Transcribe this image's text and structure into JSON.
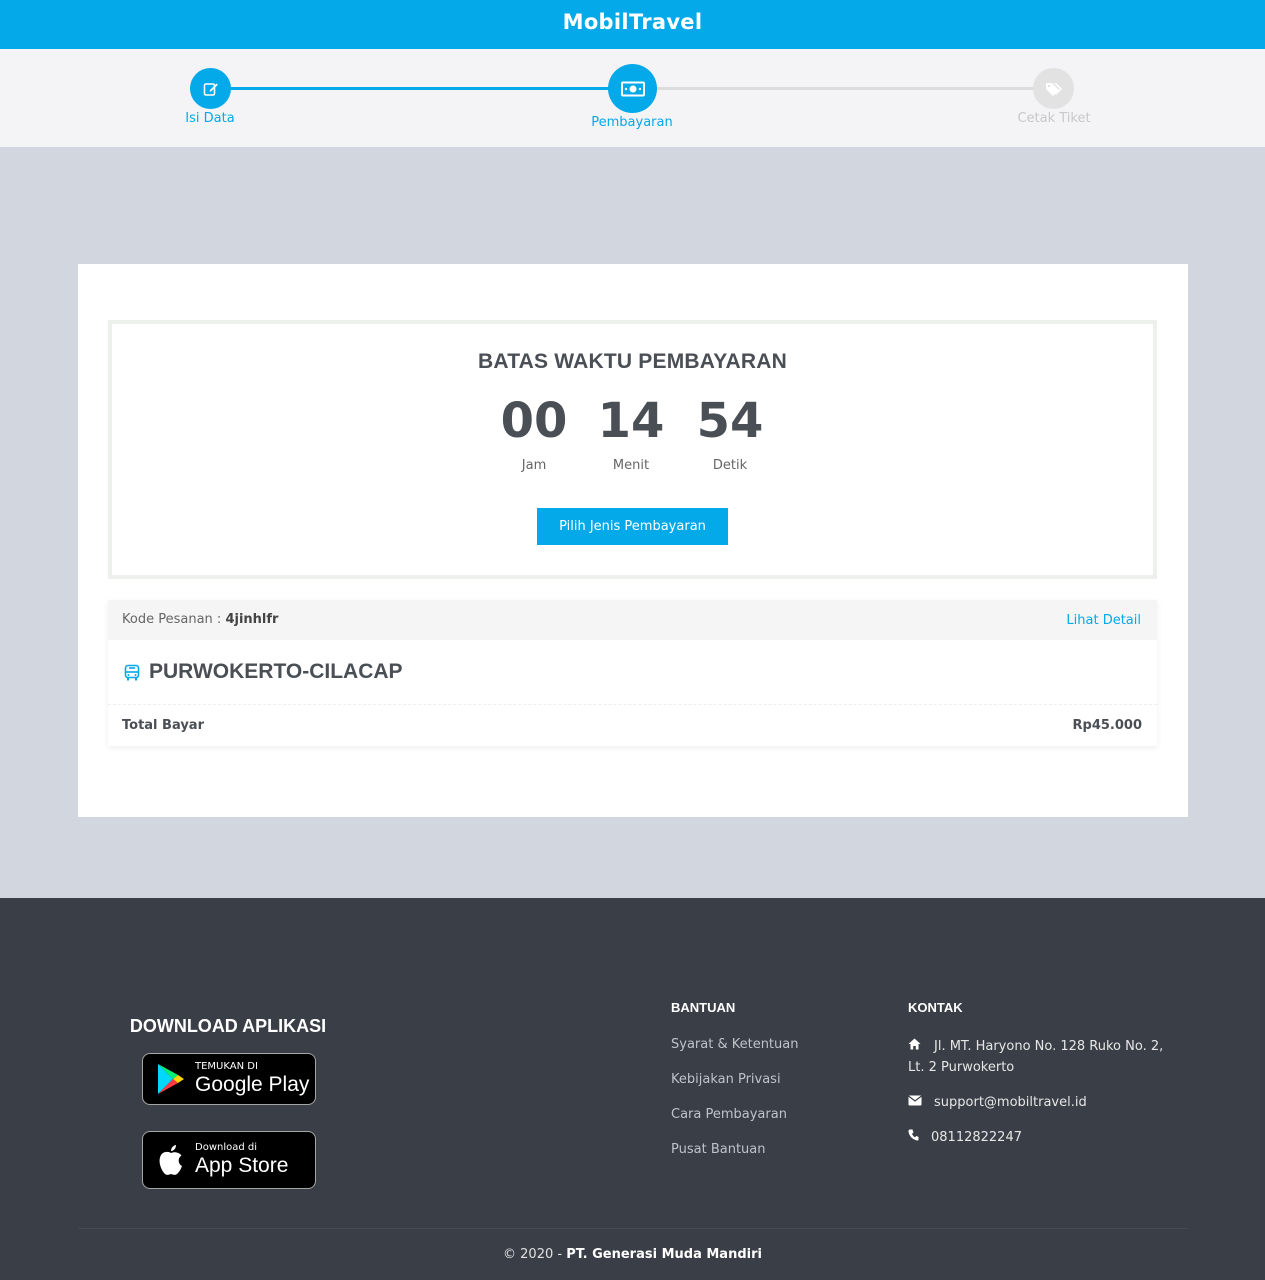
{
  "header": {
    "brand": "MobilTravel"
  },
  "stepper": {
    "steps": [
      {
        "label": "Isi Data",
        "state": "done",
        "icon": "edit-icon"
      },
      {
        "label": "Pembayaran",
        "state": "active",
        "icon": "money-icon"
      },
      {
        "label": "Cetak Tiket",
        "state": "pending",
        "icon": "tags-icon"
      }
    ]
  },
  "countdown": {
    "title": "BATAS WAKTU PEMBAYARAN",
    "hours": "00",
    "hours_label": "Jam",
    "minutes": "14",
    "minutes_label": "Menit",
    "seconds": "54",
    "seconds_label": "Detik",
    "button_label": "Pilih Jenis Pembayaran"
  },
  "order": {
    "code_label": "Kode Pesanan :",
    "code": "4jinhlfr",
    "detail_link": "Lihat Detail",
    "route": "PURWOKERTO-CILACAP",
    "total_label": "Total Bayar",
    "total_value": "Rp45.000"
  },
  "footer": {
    "download_title": "DOWNLOAD APLIKASI",
    "google_play": {
      "small": "TEMUKAN DI",
      "big": "Google Play"
    },
    "app_store": {
      "small": "Download di",
      "big": "App Store"
    },
    "help_title": "BANTUAN",
    "help_links": [
      "Syarat & Ketentuan",
      "Kebijakan Privasi",
      "Cara Pembayaran",
      "Pusat Bantuan"
    ],
    "contact_title": "KONTAK",
    "address": "Jl. MT. Haryono No. 128 Ruko No. 2, Lt. 2 Purwokerto",
    "email": "support@mobiltravel.id",
    "phone": "08112822247",
    "copyright_prefix": "© 2020 -",
    "company": "PT. Generasi Muda Mandiri"
  },
  "colors": {
    "accent": "#03a9e9",
    "footer_bg": "#3a3f47",
    "page_bg": "#d2d6de"
  }
}
